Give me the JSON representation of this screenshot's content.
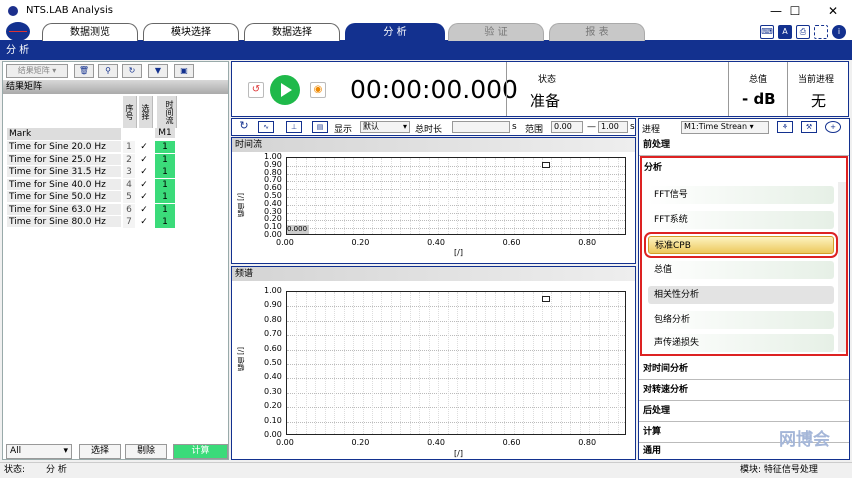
{
  "app": {
    "title": "NTS.LAB Analysis"
  },
  "window": {
    "min": "—",
    "max": "☐",
    "close": "✕"
  },
  "menu": {
    "tabs": [
      "数据测览",
      "模块选择",
      "数据选择",
      "分 析",
      "验 证",
      "报 表"
    ]
  },
  "section_title": "分 析",
  "left": {
    "toolbar": {
      "combo": "结果矩阵 ▾"
    },
    "header": "结果矩阵",
    "col_headers": [
      "序号",
      "选择",
      "时间流"
    ],
    "mark_label": "Mark",
    "m1_label": "M1",
    "rows": [
      {
        "label": "Time for Sine 20.0 Hz",
        "num": "1",
        "check": "✓",
        "val": "1"
      },
      {
        "label": "Time for Sine 25.0 Hz",
        "num": "2",
        "check": "✓",
        "val": "1"
      },
      {
        "label": "Time for Sine 31.5 Hz",
        "num": "3",
        "check": "✓",
        "val": "1"
      },
      {
        "label": "Time for Sine 40.0 Hz",
        "num": "4",
        "check": "✓",
        "val": "1"
      },
      {
        "label": "Time for Sine 50.0 Hz",
        "num": "5",
        "check": "✓",
        "val": "1"
      },
      {
        "label": "Time for Sine 63.0 Hz",
        "num": "6",
        "check": "✓",
        "val": "1"
      },
      {
        "label": "Time for Sine 80.0 Hz",
        "num": "7",
        "check": "✓",
        "val": "1"
      }
    ],
    "bottom": {
      "all": "All",
      "select": "选择",
      "remove": "剔除",
      "compute": "计算"
    }
  },
  "control": {
    "timer": "00:00:00.000",
    "status_label": "状态",
    "status_value": "准备",
    "total_label": "总值",
    "total_value": "- dB",
    "progress_label": "当前进程",
    "progress_value": "无"
  },
  "chart_toolbar": {
    "display": "显示",
    "display_value": "默认",
    "duration": "总时长",
    "unit": "s",
    "range": "范围",
    "range_from": "0.00",
    "range_to": "1.00",
    "unit2": "s"
  },
  "chart_data": [
    {
      "type": "line",
      "title": "时间流",
      "ylabel": "幅值\n[/]",
      "xlabel": "[/]",
      "yticks": [
        "1.00",
        "0.90",
        "0.80",
        "0.70",
        "0.60",
        "0.50",
        "0.40",
        "0.30",
        "0.20",
        "0.10",
        "0.00"
      ],
      "xticks": [
        "0.00",
        "0.20",
        "0.40",
        "0.60",
        "0.80"
      ],
      "ylim": [
        0,
        1
      ],
      "xlim": [
        0,
        0.9
      ],
      "cursor": "0.000",
      "series": []
    },
    {
      "type": "line",
      "title": "频谱",
      "ylabel": "幅值\n[/]",
      "xlabel": "[/]",
      "yticks": [
        "1.00",
        "0.90",
        "0.80",
        "0.70",
        "0.60",
        "0.50",
        "0.40",
        "0.30",
        "0.20",
        "0.10",
        "0.00"
      ],
      "xticks": [
        "0.00",
        "0.20",
        "0.40",
        "0.60",
        "0.80"
      ],
      "ylim": [
        0,
        1
      ],
      "xlim": [
        0,
        0.9
      ],
      "series": []
    }
  ],
  "right": {
    "process_label": "进程",
    "process_value": "M1:Time Strean ▾",
    "preprocess": "前处理",
    "analysis": "分析",
    "items": [
      "FFT信号",
      "FFT系统",
      "标准CPB",
      "总值",
      "相关性分析",
      "包络分析",
      "声传递损失"
    ],
    "sections": [
      "对时间分析",
      "对转速分析",
      "后处理",
      "计算",
      "通用"
    ]
  },
  "status": {
    "left_label": "状态:",
    "left_value": "分 析",
    "right": "模块: 特征信号处理"
  },
  "watermark": "网博会",
  "colors": {
    "accent": "#13318f",
    "green": "#1fb94a",
    "cell": "#3bdb7a",
    "highlight": "#d22"
  }
}
